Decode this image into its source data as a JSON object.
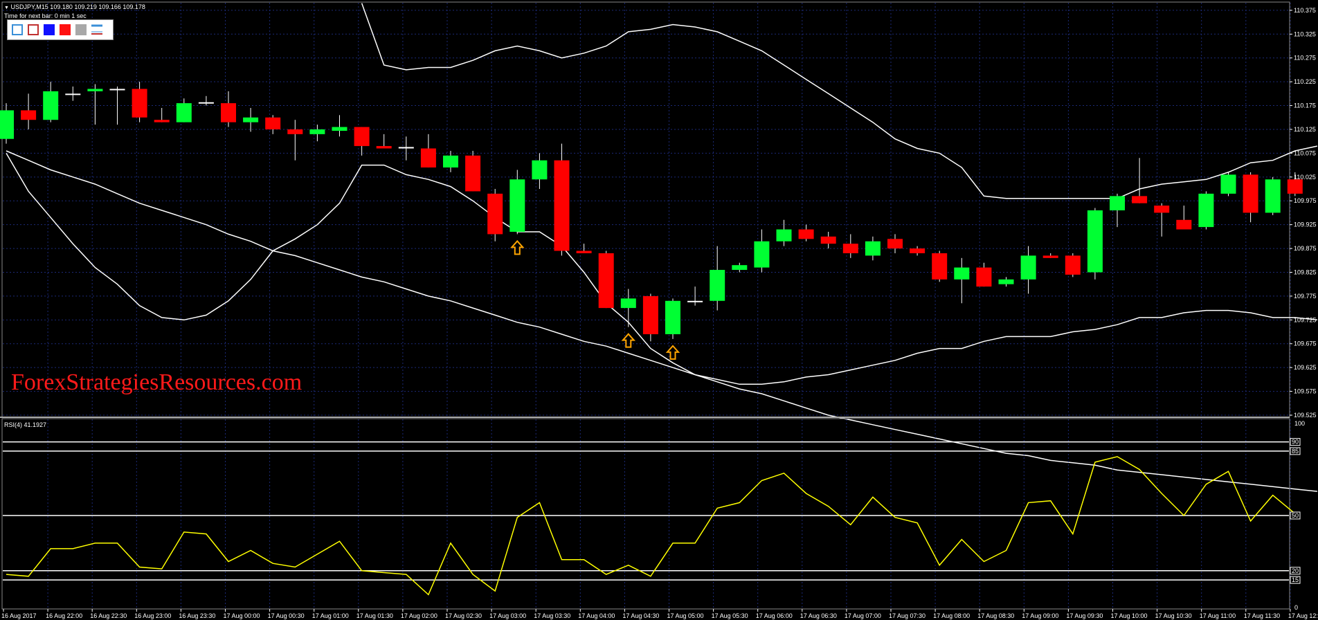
{
  "header": {
    "symbol_line": "USDJPY,M15  109.180 109.219 109.166 109.178",
    "timer": "Time for next bar: 0 min 1 sec"
  },
  "toolbar": {
    "items": [
      {
        "name": "bullish-outline-swatch",
        "color": "#3a8fd8"
      },
      {
        "name": "bearish-outline-swatch",
        "color": "#c03030"
      },
      {
        "name": "blue-swatch",
        "color": "#1010ff"
      },
      {
        "name": "red-swatch",
        "color": "#ff1010"
      },
      {
        "name": "gray-swatch",
        "color": "#a8a8a8"
      },
      {
        "name": "lines-swatch",
        "color": "#3a8fd8"
      }
    ]
  },
  "watermark": "ForexStrategiesResources.com",
  "rsi_label": "RSI(4) 41.1927",
  "colors": {
    "bull": "#00ff33",
    "bear": "#ff0000",
    "band": "#ffffff",
    "rsi": "#ffff00",
    "arrow": "#ffa500",
    "grid": "#1c2a78"
  },
  "chart_data": [
    {
      "type": "candlestick",
      "symbol": "USDJPY",
      "timeframe": "M15",
      "ylim": [
        109.525,
        110.385
      ],
      "y_ticks": [
        "110.375",
        "110.325",
        "110.275",
        "110.225",
        "110.175",
        "110.125",
        "110.075",
        "110.025",
        "109.975",
        "109.925",
        "109.875",
        "109.825",
        "109.775",
        "109.725",
        "109.675",
        "109.625",
        "109.575",
        "109.525"
      ],
      "x_ticks": [
        "16 Aug 2017",
        "16 Aug 22:00",
        "16 Aug 22:30",
        "16 Aug 23:00",
        "16 Aug 23:30",
        "17 Aug 00:00",
        "17 Aug 00:30",
        "17 Aug 01:00",
        "17 Aug 01:30",
        "17 Aug 02:00",
        "17 Aug 02:30",
        "17 Aug 03:00",
        "17 Aug 03:30",
        "17 Aug 04:00",
        "17 Aug 04:30",
        "17 Aug 05:00",
        "17 Aug 05:30",
        "17 Aug 06:00",
        "17 Aug 06:30",
        "17 Aug 07:00",
        "17 Aug 07:30",
        "17 Aug 08:00",
        "17 Aug 08:30",
        "17 Aug 09:00",
        "17 Aug 09:30",
        "17 Aug 10:00",
        "17 Aug 10:30",
        "17 Aug 11:00",
        "17 Aug 11:30",
        "17 Aug 12:"
      ],
      "candles": [
        {
          "o": 110.105,
          "h": 110.18,
          "l": 110.095,
          "c": 110.165
        },
        {
          "o": 110.165,
          "h": 110.2,
          "l": 110.125,
          "c": 110.145
        },
        {
          "o": 110.145,
          "h": 110.225,
          "l": 110.14,
          "c": 110.205
        },
        {
          "o": 110.2,
          "h": 110.215,
          "l": 110.185,
          "c": 110.2
        },
        {
          "o": 110.205,
          "h": 110.22,
          "l": 110.135,
          "c": 110.21
        },
        {
          "o": 110.21,
          "h": 110.215,
          "l": 110.135,
          "c": 110.21
        },
        {
          "o": 110.21,
          "h": 110.225,
          "l": 110.14,
          "c": 110.15
        },
        {
          "o": 110.145,
          "h": 110.17,
          "l": 110.14,
          "c": 110.14
        },
        {
          "o": 110.14,
          "h": 110.19,
          "l": 110.14,
          "c": 110.18
        },
        {
          "o": 110.182,
          "h": 110.195,
          "l": 110.175,
          "c": 110.18
        },
        {
          "o": 110.18,
          "h": 110.205,
          "l": 110.13,
          "c": 110.14
        },
        {
          "o": 110.14,
          "h": 110.17,
          "l": 110.12,
          "c": 110.15
        },
        {
          "o": 110.15,
          "h": 110.155,
          "l": 110.115,
          "c": 110.125
        },
        {
          "o": 110.125,
          "h": 110.145,
          "l": 110.06,
          "c": 110.115
        },
        {
          "o": 110.115,
          "h": 110.135,
          "l": 110.1,
          "c": 110.125
        },
        {
          "o": 110.122,
          "h": 110.155,
          "l": 110.11,
          "c": 110.13
        },
        {
          "o": 110.13,
          "h": 110.13,
          "l": 110.07,
          "c": 110.09
        },
        {
          "o": 110.09,
          "h": 110.115,
          "l": 110.085,
          "c": 110.085
        },
        {
          "o": 110.088,
          "h": 110.11,
          "l": 110.06,
          "c": 110.085
        },
        {
          "o": 110.085,
          "h": 110.115,
          "l": 110.045,
          "c": 110.045
        },
        {
          "o": 110.045,
          "h": 110.08,
          "l": 110.035,
          "c": 110.07
        },
        {
          "o": 110.07,
          "h": 110.08,
          "l": 109.995,
          "c": 109.995
        },
        {
          "o": 109.99,
          "h": 110.0,
          "l": 109.89,
          "c": 109.905
        },
        {
          "o": 109.91,
          "h": 110.04,
          "l": 109.905,
          "c": 110.02
        },
        {
          "o": 110.02,
          "h": 110.075,
          "l": 110.0,
          "c": 110.06
        },
        {
          "o": 110.06,
          "h": 110.095,
          "l": 109.86,
          "c": 109.87
        },
        {
          "o": 109.87,
          "h": 109.885,
          "l": 109.865,
          "c": 109.865
        },
        {
          "o": 109.865,
          "h": 109.87,
          "l": 109.75,
          "c": 109.75
        },
        {
          "o": 109.75,
          "h": 109.79,
          "l": 109.71,
          "c": 109.77
        },
        {
          "o": 109.775,
          "h": 109.78,
          "l": 109.68,
          "c": 109.695
        },
        {
          "o": 109.695,
          "h": 109.77,
          "l": 109.685,
          "c": 109.765
        },
        {
          "o": 109.765,
          "h": 109.795,
          "l": 109.755,
          "c": 109.765
        },
        {
          "o": 109.765,
          "h": 109.88,
          "l": 109.745,
          "c": 109.83
        },
        {
          "o": 109.83,
          "h": 109.845,
          "l": 109.825,
          "c": 109.84
        },
        {
          "o": 109.835,
          "h": 109.915,
          "l": 109.825,
          "c": 109.89
        },
        {
          "o": 109.89,
          "h": 109.935,
          "l": 109.88,
          "c": 109.915
        },
        {
          "o": 109.915,
          "h": 109.925,
          "l": 109.89,
          "c": 109.895
        },
        {
          "o": 109.9,
          "h": 109.91,
          "l": 109.875,
          "c": 109.885
        },
        {
          "o": 109.885,
          "h": 109.905,
          "l": 109.855,
          "c": 109.865
        },
        {
          "o": 109.86,
          "h": 109.9,
          "l": 109.85,
          "c": 109.89
        },
        {
          "o": 109.895,
          "h": 109.905,
          "l": 109.865,
          "c": 109.875
        },
        {
          "o": 109.875,
          "h": 109.88,
          "l": 109.86,
          "c": 109.865
        },
        {
          "o": 109.865,
          "h": 109.87,
          "l": 109.805,
          "c": 109.81
        },
        {
          "o": 109.81,
          "h": 109.855,
          "l": 109.76,
          "c": 109.835
        },
        {
          "o": 109.835,
          "h": 109.845,
          "l": 109.795,
          "c": 109.795
        },
        {
          "o": 109.8,
          "h": 109.815,
          "l": 109.795,
          "c": 109.81
        },
        {
          "o": 109.81,
          "h": 109.88,
          "l": 109.78,
          "c": 109.86
        },
        {
          "o": 109.86,
          "h": 109.865,
          "l": 109.855,
          "c": 109.855
        },
        {
          "o": 109.86,
          "h": 109.865,
          "l": 109.815,
          "c": 109.82
        },
        {
          "o": 109.825,
          "h": 109.96,
          "l": 109.81,
          "c": 109.955
        },
        {
          "o": 109.955,
          "h": 109.99,
          "l": 109.92,
          "c": 109.985
        },
        {
          "o": 109.985,
          "h": 110.065,
          "l": 109.97,
          "c": 109.97
        },
        {
          "o": 109.965,
          "h": 109.97,
          "l": 109.9,
          "c": 109.95
        },
        {
          "o": 109.935,
          "h": 109.965,
          "l": 109.92,
          "c": 109.915
        },
        {
          "o": 109.92,
          "h": 109.995,
          "l": 109.915,
          "c": 109.99
        },
        {
          "o": 109.99,
          "h": 110.035,
          "l": 109.985,
          "c": 110.03
        },
        {
          "o": 110.03,
          "h": 110.035,
          "l": 109.93,
          "c": 109.95
        },
        {
          "o": 109.95,
          "h": 110.025,
          "l": 109.945,
          "c": 110.02
        },
        {
          "o": 110.02,
          "h": 110.035,
          "l": 109.985,
          "c": 109.99
        }
      ],
      "bollinger": {
        "upper": [
          null,
          null,
          null,
          null,
          null,
          null,
          null,
          null,
          null,
          null,
          null,
          null,
          null,
          null,
          null,
          null,
          110.39,
          110.26,
          110.25,
          110.255,
          110.255,
          110.27,
          110.29,
          110.3,
          110.29,
          110.275,
          110.285,
          110.3,
          110.33,
          110.335,
          110.345,
          110.34,
          110.33,
          110.31,
          110.29,
          110.26,
          110.23,
          110.2,
          110.17,
          110.14,
          110.105,
          110.085,
          110.075,
          110.045,
          109.985,
          109.98,
          109.98,
          109.98,
          109.98,
          109.98,
          109.98,
          110.0,
          110.01,
          110.015,
          110.02,
          110.035,
          110.055,
          110.06,
          110.08,
          110.09
        ],
        "middle": [
          110.08,
          110.06,
          110.04,
          110.025,
          110.01,
          109.99,
          109.97,
          109.955,
          109.94,
          109.925,
          109.905,
          109.89,
          109.87,
          109.86,
          109.845,
          109.83,
          109.815,
          109.805,
          109.79,
          109.775,
          109.765,
          109.75,
          109.735,
          109.72,
          109.71,
          109.695,
          109.68,
          109.67,
          109.655,
          109.64,
          109.625,
          109.61,
          109.595,
          109.58,
          109.57,
          109.555,
          109.54,
          109.525,
          109.515,
          109.505,
          109.495,
          109.485,
          109.475,
          109.465,
          109.455,
          109.445,
          109.44,
          109.43,
          109.425,
          109.42,
          109.41,
          109.405,
          109.4,
          109.395,
          109.39,
          109.385,
          109.38,
          109.375,
          109.37,
          109.365
        ],
        "lower": [
          110.075,
          109.995,
          109.94,
          109.885,
          109.835,
          109.8,
          109.755,
          109.73,
          109.725,
          109.735,
          109.765,
          109.81,
          109.87,
          109.895,
          109.925,
          109.97,
          110.05,
          110.05,
          110.03,
          110.02,
          110.005,
          109.975,
          109.94,
          109.91,
          109.91,
          109.88,
          109.825,
          109.76,
          109.72,
          109.665,
          109.635,
          109.61,
          109.6,
          109.59,
          109.59,
          109.595,
          109.605,
          109.61,
          109.62,
          109.63,
          109.64,
          109.655,
          109.665,
          109.665,
          109.68,
          109.69,
          109.69,
          109.69,
          109.7,
          109.705,
          109.715,
          109.73,
          109.73,
          109.74,
          109.745,
          109.745,
          109.74,
          109.73,
          109.73,
          109.725
        ]
      },
      "buy_arrows": [
        23,
        28,
        30
      ]
    },
    {
      "type": "line",
      "title": "RSI(4) 41.1927",
      "ylim": [
        0,
        100
      ],
      "levels": [
        90,
        85,
        50,
        20,
        15
      ],
      "level_labels": [
        "100",
        "90",
        "85",
        "50",
        "20",
        "15",
        "0"
      ],
      "series": [
        {
          "values": [
            18,
            17,
            32,
            32,
            35,
            35,
            22,
            21,
            41,
            40,
            25,
            31,
            24,
            22,
            29,
            36,
            20,
            19,
            18,
            7,
            35,
            18,
            9,
            49,
            57,
            26,
            26,
            18,
            23,
            17,
            35,
            35,
            54,
            57,
            69,
            73,
            62,
            55,
            45,
            60,
            49,
            46,
            23,
            37,
            25,
            31,
            57,
            58,
            40,
            79,
            82,
            75,
            62,
            50,
            67,
            74,
            47,
            61,
            51
          ]
        }
      ]
    }
  ]
}
